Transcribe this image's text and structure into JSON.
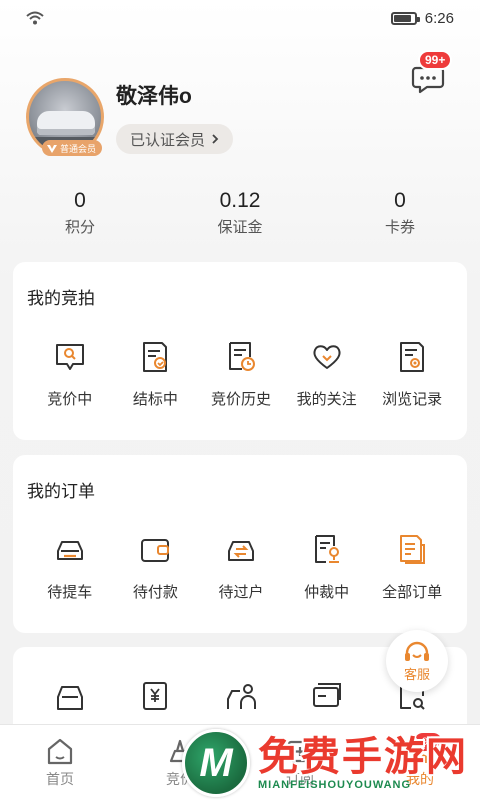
{
  "status": {
    "time": "6:26",
    "battery_level": 0.85
  },
  "header": {
    "message_badge": "99+"
  },
  "profile": {
    "username": "敬泽伟o",
    "member_tag": "普通会员",
    "verify_label": "已认证会员"
  },
  "stats": [
    {
      "value": "0",
      "label": "积分"
    },
    {
      "value": "0.12",
      "label": "保证金"
    },
    {
      "value": "0",
      "label": "卡券"
    }
  ],
  "auction": {
    "title": "我的竞拍",
    "items": [
      {
        "label": "竞价中",
        "icon": "bidding-icon"
      },
      {
        "label": "结标中",
        "icon": "closing-icon"
      },
      {
        "label": "竞价历史",
        "icon": "history-icon"
      },
      {
        "label": "我的关注",
        "icon": "favorite-icon"
      },
      {
        "label": "浏览记录",
        "icon": "browse-record-icon"
      }
    ]
  },
  "orders": {
    "title": "我的订单",
    "items": [
      {
        "label": "待提车",
        "icon": "car-pickup-icon"
      },
      {
        "label": "待付款",
        "icon": "wallet-icon"
      },
      {
        "label": "待过户",
        "icon": "transfer-icon"
      },
      {
        "label": "仲裁中",
        "icon": "arbitration-icon"
      },
      {
        "label": "全部订单",
        "icon": "all-orders-icon"
      }
    ]
  },
  "tools": {
    "icons": [
      "car-icon",
      "price-icon",
      "person-car-icon",
      "card-icon",
      "search-doc-icon"
    ]
  },
  "service": {
    "label": "客服"
  },
  "tabbar": {
    "tabs": [
      {
        "label": "首页",
        "icon": "home-icon"
      },
      {
        "label": "竞价",
        "icon": "bid-tab-icon"
      },
      {
        "label": "订阅",
        "icon": "subscribe-icon"
      },
      {
        "label": "我的",
        "icon": "profile-tab-icon",
        "badge": "99"
      }
    ]
  },
  "watermark": {
    "logo_letter": "M",
    "cn": "免费手游网",
    "en": "MIANFEISHOUYOUWANG"
  },
  "colors": {
    "accent": "#e9872f",
    "badge": "#ee3b3b"
  }
}
